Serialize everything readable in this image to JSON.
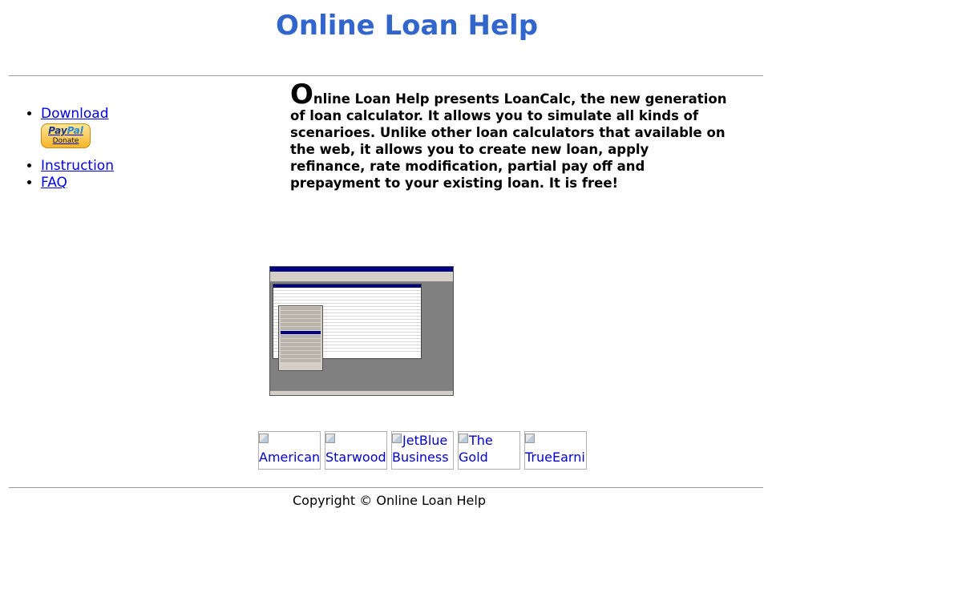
{
  "header": {
    "title": "Online Loan Help"
  },
  "nav": {
    "items": [
      {
        "label": "Download"
      },
      {
        "label": "Instruction"
      },
      {
        "label": "FAQ"
      }
    ],
    "donate": {
      "logo_pay": "Pay",
      "logo_pal": "Pal",
      "label": "Donate"
    }
  },
  "intro": {
    "dropcap": "O",
    "text": "nline Loan Help presents LoanCalc, the new generation of loan calculator. It allows you to simulate all kinds of scenarioes. Unlike other loan calculators that available on the web, it allows you to create new loan, apply refinance, rate modification, partial pay off and prepayment to your existing loan. It is free!"
  },
  "ads": [
    {
      "alt": "American Express"
    },
    {
      "alt": "Starwood Preferred"
    },
    {
      "alt": "JetBlue Business"
    },
    {
      "alt": "The Gold"
    },
    {
      "alt": "TrueEarnings Business"
    }
  ],
  "footer": {
    "copyright": "Copyright © Online Loan Help"
  },
  "colors": {
    "title": "#3366cc",
    "link": "#0000ee",
    "rule": "#999999"
  },
  "icons": {
    "donate": "paypal-donate-icon",
    "ad_placeholder": "broken-image-icon"
  }
}
